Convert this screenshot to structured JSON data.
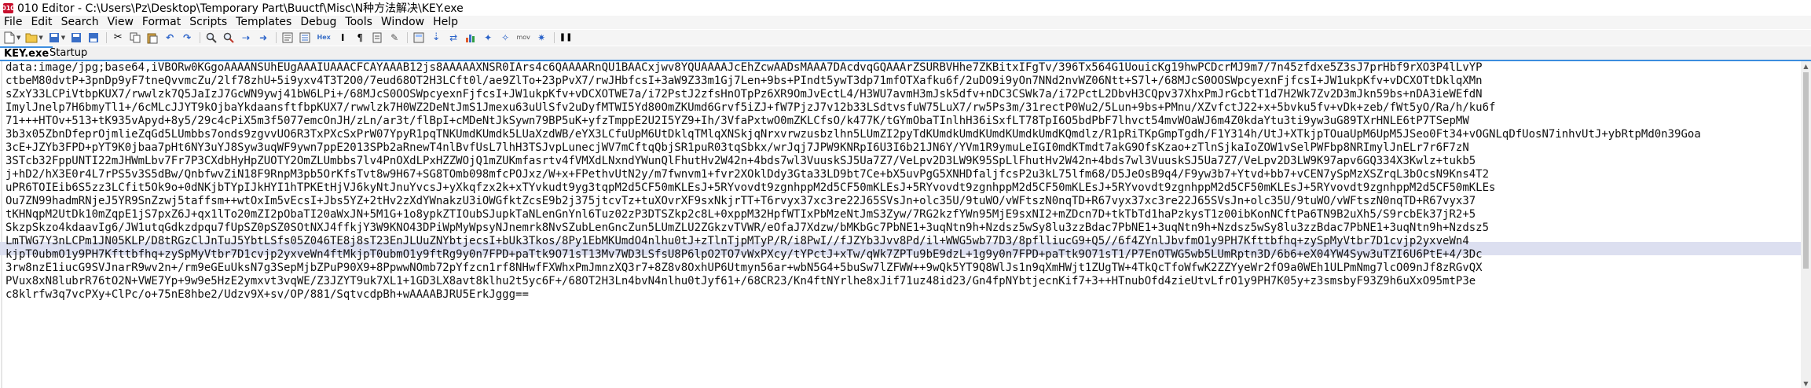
{
  "window": {
    "title": "010 Editor - C:\\Users\\Pz\\Desktop\\Temporary Part\\Buuctf\\Misc\\N种方法解决\\KEY.exe",
    "app_icon_text": "010"
  },
  "menu": [
    "File",
    "Edit",
    "Search",
    "View",
    "Format",
    "Scripts",
    "Templates",
    "Debug",
    "Tools",
    "Window",
    "Help"
  ],
  "toolbar": {
    "icons": [
      "new-file-icon",
      "open-folder-icon",
      "save-icon",
      "save-all-icon",
      "close-file-icon",
      "cut-icon",
      "copy-icon",
      "paste-icon",
      "undo-icon",
      "redo-icon",
      "find-icon",
      "replace-icon",
      "find-next-icon",
      "goto-icon",
      "hex-view-icon",
      "text-view-icon",
      "show-whitespace-icon",
      "word-wrap-icon",
      "calculator-icon",
      "inspector-icon",
      "bookmark-icon",
      "compare-icon",
      "histogram-icon",
      "checksum-icon",
      "mov-label-icon",
      "script-icon",
      "pause-icon"
    ],
    "hex_label": "Hex",
    "mov_label": "mov"
  },
  "tabs": [
    {
      "label": "KEY.exe",
      "active": true,
      "close": "×"
    },
    {
      "label": "Startup",
      "active": false
    }
  ],
  "editor": {
    "lines": [
      "data:image/jpg;base64,iVBORw0KGgoAAAANSUhEUgAAAIUAAACFCAYAAAB12js8AAAAAXNSR0IArs4c6QAAAARnQU1BAACxjwv8YQUAAAAJcEhZcwAADsMAAA7DAcdvqGQAAArZSURBVHhe7ZKBitxIFgTv/396Tx564G1UouicKg19hwPCDcrMJ9m7/7n45zfdxe5Z3sJ7prHbf9rXO3P4lLvYP",
      "ctbeM80dvtP+3pnDp9yF7tneQvvmcZu/2lf78zhU+5i9yxv4T3T2O0/7eud68OT2H3LCft0l/ae9ZlTo+23pPvX7/rwJHbfcsI+3aW9Z33m1Gj7Len+9bs+PIndt5ywT3dp71mfOTXafku6f/2uDO9i9yOn7NNd2nvWZ06Ntt+S7l+/68MJcS0OOSWpcyexnFjfcsI+JW1ukpKfv+vDCXOTtDklqXMn",
      "sZxY33LCPiVtbpKUX7/rwwlzk7Q5JaIzJ7GcWN9ywj41bW6LPi+/68MJcS0OOSWpcyexnFjfcsI+JW1ukpKfv+vDCXOTWE7a/i72PstJ2zfsHnOTpPz6XR9OmJvEctL4/H3WU7avmH3mJsk5dfv+nDC3CSWk7a/i72PctL2DbvH3CQpv37XhxPmJrGcbtT1d7H2Wk7Zv2D3mJkn59bs+nDA3ieWEfdN",
      "ImylJnelp7H6bmyTl1+/6cMLcJJYT9kOjbaYkdaansftfbpKUX7/rwwlzk7H0WZ2DeNtJmS1Jmexu63uUlSfv2uDyfMTWI5Yd80OmZKUmd6Grvf5iZJ+fW7PjzJ7v12b33LSdtvsfuW75LuX7/rw5Ps3m/31rectP0Wu2/5Lun+9bs+PMnu/XZvfctJ22+x+5bvku5fv+vDk+zeb/fWt5yO/Ra/h/ku6f",
      "71+++HTOv+513+tK935vApyd+8y5/29c4cPiX5m3f5077emcOnJH/zLn/ar3t/flBpI+cMDeNtJkSywn79BP5uK+yfzTmppE2U2I5YZ9+Ih/3VfaPxtwO0mZKLCfsO/k477K/tGYmObaTInlhH36iSxfLT78TpI6O5bdPbF7lhvct54mvWOaWJ6m4Z0kdaYtu3ti9yw3uG89TXrHNLE6tP7TSepMW",
      "3b3x05ZbnDfeprOjmlieZqGd5LUmbbs7onds9zgvvUO6R3TxPXcSxPrW07YpyR1pqTNKUmdKUmdk5LUaXzdWB/eYX3LCfuUpM6UtDklqTMlqXNSkjqNrxvrwzusbzlhn5LUmZI2pyTdKUmdkUmdKUmdKUmdkUmdKQmdlz/R1pRiTKpGmpTgdh/F1Y314h/UtJ+XTkjpTOuaUpM6UpM5JSeo0Ft34+vOGNLqDfUosN7inhvUtJ+ybRtpMd0n39Goa",
      "3cE+JZYb3FPD+pYT9K0jbaa7pHt6NY3uYJ8Syw3uqWF9ywn7ppE2013SPb2aRnewT4nlBvfUsL7lhH3TSJvpLunecjWV7mCftqQbjSR1puR03tqSbkx/wrJqj7JPW9KNRpI6U3I6b21JN6Y/YVm1R9ymuLeIGI0mdKTmdt7akG9OfsKzao+zTlnSjkaIoZOW1vSelPWFbp8NRImylJnELr7r6F7zN",
      "3STcb32FppUNTI22mJHWmLbv7Fr7P3CXdbHyHpZUOTY2OmZLUmbbs7lv4PnOXdLPxHZZWOjQ1mZUKmfasrtv4fVMXdLNxndYWunQlFhutHv2W42n+4bds7wl3VuuskSJ5Ua7Z7/VeLpv2D3LW9K95SpLlFhutHv2W42n+4bds7wl3VuuskSJ5Ua7Z7/VeLpv2D3LW9K97apv6GQ334X3Kwlz+tukb5",
      "j+hD2/hX3E0r4L7rPS5v3S5dBw/QnbfwvZiN18F9RnpM3pb5OrKfsTvt8w9H67+SG8TOmb098mfcPOJxz/W+x+FPethvUtN2y/m7fwnvm1+fvr2XOklDdy3Gta33LD9bt7Ce+bX5uvPgG5XNHDfaljfcsP2u3kL75lfm68/D5JeOsB9q4/F9yw3b7+Ytvd+bb7+vCEN7ySpMzXSZrqL3bOcsN9Kns4T2",
      "uPR6TOIEib6S5zz3LCfit5Ok9o+0dNKjbTYpIJkHYI1hTPKEtHjVJ6kyNtJnuYvcsJ+yXkqfzx2k+xTYvkudt9yg3tqpM2d5CF50mKLEsJ+5RYvovdt9zgnhppM2d5CF50mKLEsJ+5RYvovdt9zgnhppM2d5CF50mKLEsJ+5RYvovdt9zgnhppM2d5CF50mKLEsJ+5RYvovdt9zgnhppM2d5CF50mKLEs",
      "Ou7ZN99hadmRNjeJ5YR9SnZzwj5taffsm++wtOxIm5vEcsI+Jbs5YZ+2tHv2zXdYWnakzU3iOWGfktZcsE9b2j375jtcvTz+tuXOvrXF9sxNkjrTT+T6rvyx37xc3re22J65SVsJn+olc35U/9tuWO/vWFtszN0nqTD+R67vyx37xc3re22J65SVsJn+olc35U/9tuWO/vWFtszN0nqTD+R67vyx37",
      "tKHNqpM2UtDk10mZqpE1jS7pxZ6J+qx1lTo20mZI2pObaTI20aWxJN+5M1G+1o8ypkZTIOubSJupkTaNLenGnYnl6Tuz02zP3DTSZkp2c8L+0xppM32HpfWTIxPbMzeNtJmS3Zyw/7RG2kzfYWn95MjE9sxNI2+mZDcn7D+tkTbTd1haPzkysT1z00ibKonNCftPa6TN9B2uXh5/S9rcbEk37jR2+5",
      "SkzpSkzo4kdaavIg6/JW1utqGdkzdpqu7fUpSZ0pSZ0SOtNXJ4ffkjY3W9KNO43DPiWpMyWpsyNJnemrk8NvSZubLenGncZun5LUmZLU2ZGkzvTVWR/eOfaJ7Xdzw/bMKbGc7PbNE1+3uqNtn9h+Nzdsz5wSy8lu3zzBdac7PbNE1+3uqNtn9h+Nzdsz5wSy8lu3zzBdac7PbNE1+3uqNtn9h+Nzdsz5",
      "LmTWG7Y3nLCPm1JN05KLP/D8tRGzClJnTuJ5YbtLSfs05Z046TE8j8sT23EnJLUuZNYbtjecsI+bUk3Tkos/8Py1EbMKUmdO4nlhu0tJ+zTlnTjpMTyP/R/i8PwI//fJZYb3Jvv8Pd/il+WWG5wb77D3/8pflliucG9+Q5//6f4ZYnlJbvfmO1y9PH7Kfttbfhq+zySpMyVtbr7D1cvjp2yxveWn4",
      "kjpT0ubmO1y9PH7Kfttbfhq+zySpMyVtbr7D1cvjp2yxveWn4ftMkjpT0ubmO1y9ftRg9y0n7FPD+paTtk9O71sT13Mv7WD3LSfsU8P6lpO2TO7vWxPXcy/tYPctJ+xTw/qWk7ZPTu9bE9dzL+1g9y0n7FPD+paTtk9O71sT1/P7EnOTWG5wb5LUmRptn3D/6b6+eX04YW4Syw3uTZI6U6PtE+4/3Dc",
      "3rw8nzE1iucG9SVJnarR9wv2n+/rm9eGEuUksN7g3SepMjbZPuP90X9+8PpwwNOmb72pYfzcn1rf8NHwfFXWhxPmJmnzXQ3r7+8Z8v8OxhUP6Utmyn56ar+wbN5G4+5buSw7lZFWW++9wQk5YT9Q8WlJs1n9qXmHWjt1ZUgTW+4TkQcTfoWfwK2ZZYyeWr2fO9a0WEh1ULPmNmg7lcO09nJf8zRGvQX",
      "PVux8xN8lubrR76tO2N+VWE7Yp+9w9e5HzE2ymxvt3vqWE/Z3JZYT9uk7XL1+1GD3LX8avt8klhu2t5yc6F+/68OT2H3Ln4bvN4nlhu0tJyf61+/68CR23/Kn4ftNYrlhe8xJif71uz48id23/Gn4fpNYbtjecnKif7+3++HTnubOfd4zieUtvLfrO1y9PH7K05y+z3smsbyF93Z9h6uXxO95mtP3e",
      "c8klrfw3q7vcPXy+ClPc/o+75nE8hbe2/Udzv9X+sv/OP/881/SqtvcdpBh+wAAAABJRU5ErkJggg=="
    ]
  }
}
